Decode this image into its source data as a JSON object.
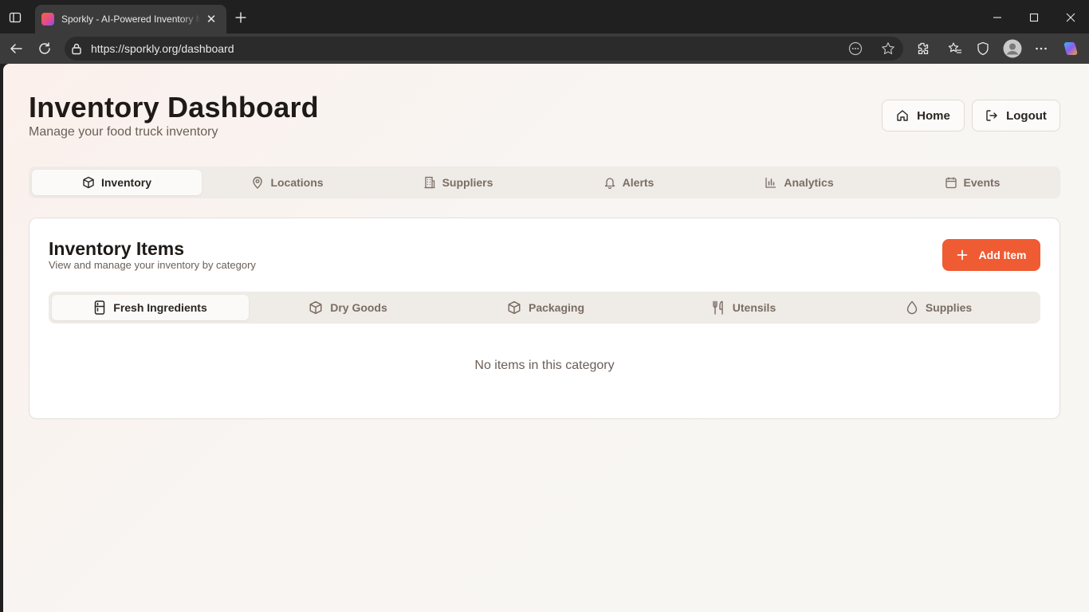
{
  "browser": {
    "tab_title": "Sporkly - AI-Powered Inventory Management",
    "tab_close": "✕",
    "new_tab": "+",
    "url": "https://sporkly.org/dashboard",
    "icons": [
      "tab-actions-icon",
      "back-icon",
      "refresh-icon",
      "lock-icon",
      "more-page-icon",
      "favorite-star-icon",
      "extensions-icon",
      "favorites-icon",
      "shield-icon",
      "profile-icon",
      "menu-dots-icon",
      "copilot-icon",
      "minimize-icon",
      "maximize-icon",
      "close-icon"
    ]
  },
  "header": {
    "title": "Inventory Dashboard",
    "subtitle": "Manage your food truck inventory",
    "home_label": "Home",
    "logout_label": "Logout"
  },
  "main_tabs": [
    {
      "label": "Inventory",
      "icon": "package-icon",
      "active": true
    },
    {
      "label": "Locations",
      "icon": "map-pin-icon",
      "active": false
    },
    {
      "label": "Suppliers",
      "icon": "building-icon",
      "active": false
    },
    {
      "label": "Alerts",
      "icon": "bell-icon",
      "active": false
    },
    {
      "label": "Analytics",
      "icon": "bar-chart-icon",
      "active": false
    },
    {
      "label": "Events",
      "icon": "calendar-icon",
      "active": false
    }
  ],
  "card": {
    "title": "Inventory Items",
    "subtitle": "View and manage your inventory by category",
    "add_label": "Add Item",
    "empty_text": "No items in this category"
  },
  "category_tabs": [
    {
      "label": "Fresh Ingredients",
      "icon": "refrigerator-icon",
      "active": true
    },
    {
      "label": "Dry Goods",
      "icon": "package-icon",
      "active": false
    },
    {
      "label": "Packaging",
      "icon": "package-icon",
      "active": false
    },
    {
      "label": "Utensils",
      "icon": "utensils-icon",
      "active": false
    },
    {
      "label": "Supplies",
      "icon": "droplet-icon",
      "active": false
    }
  ],
  "colors": {
    "accent": "#ef5b33",
    "tab_bg": "#efebe6",
    "text_dark": "#1e1a17",
    "text_muted": "#6b5f57"
  }
}
